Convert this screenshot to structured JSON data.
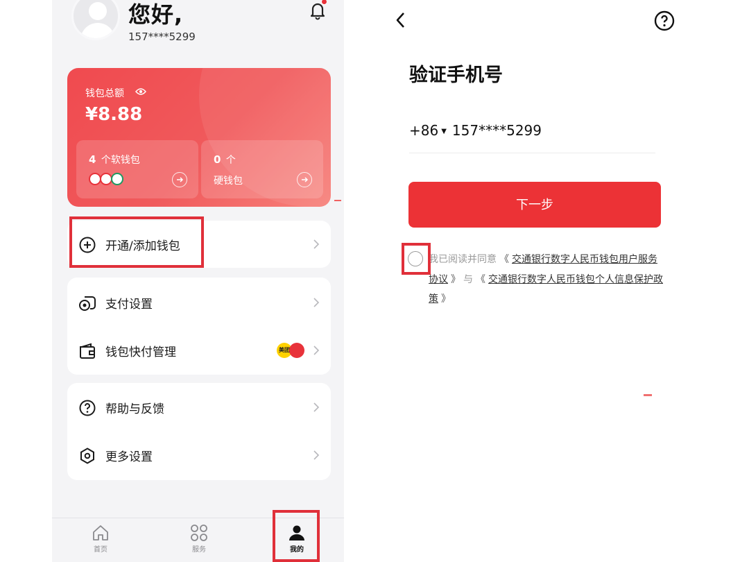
{
  "left_screen": {
    "greeting": "您好,",
    "phone": "157****5299",
    "wallet": {
      "label": "钱包总额",
      "amount": "¥8.88",
      "soft": {
        "count": "4",
        "title_suffix": "个软钱包"
      },
      "hard": {
        "count": "0",
        "title_suffix": "个",
        "subtitle": "硬钱包"
      }
    },
    "menu": {
      "add_wallet": "开通/添加钱包",
      "payment_settings": "支付设置",
      "quick_pay": "钱包快付管理",
      "quick_pay_merchant": "美团",
      "help": "帮助与反馈",
      "more_settings": "更多设置"
    },
    "tabs": [
      {
        "label": "首页",
        "icon": "home-icon"
      },
      {
        "label": "服务",
        "icon": "grid-icon"
      },
      {
        "label": "我的",
        "icon": "person-icon"
      }
    ],
    "accent_color": "#ec3236"
  },
  "right_screen": {
    "title": "验证手机号",
    "country_code": "+86",
    "phone": "157****5299",
    "next_button": "下一步",
    "agreement": {
      "prefix": "我已阅读并同意",
      "open_quote": "《",
      "close_quote": "》",
      "doc1": "交通银行数字人民币钱包用户服务协议",
      "and": "与",
      "doc2": "交通银行数字人民币钱包个人信息保护政策"
    }
  }
}
